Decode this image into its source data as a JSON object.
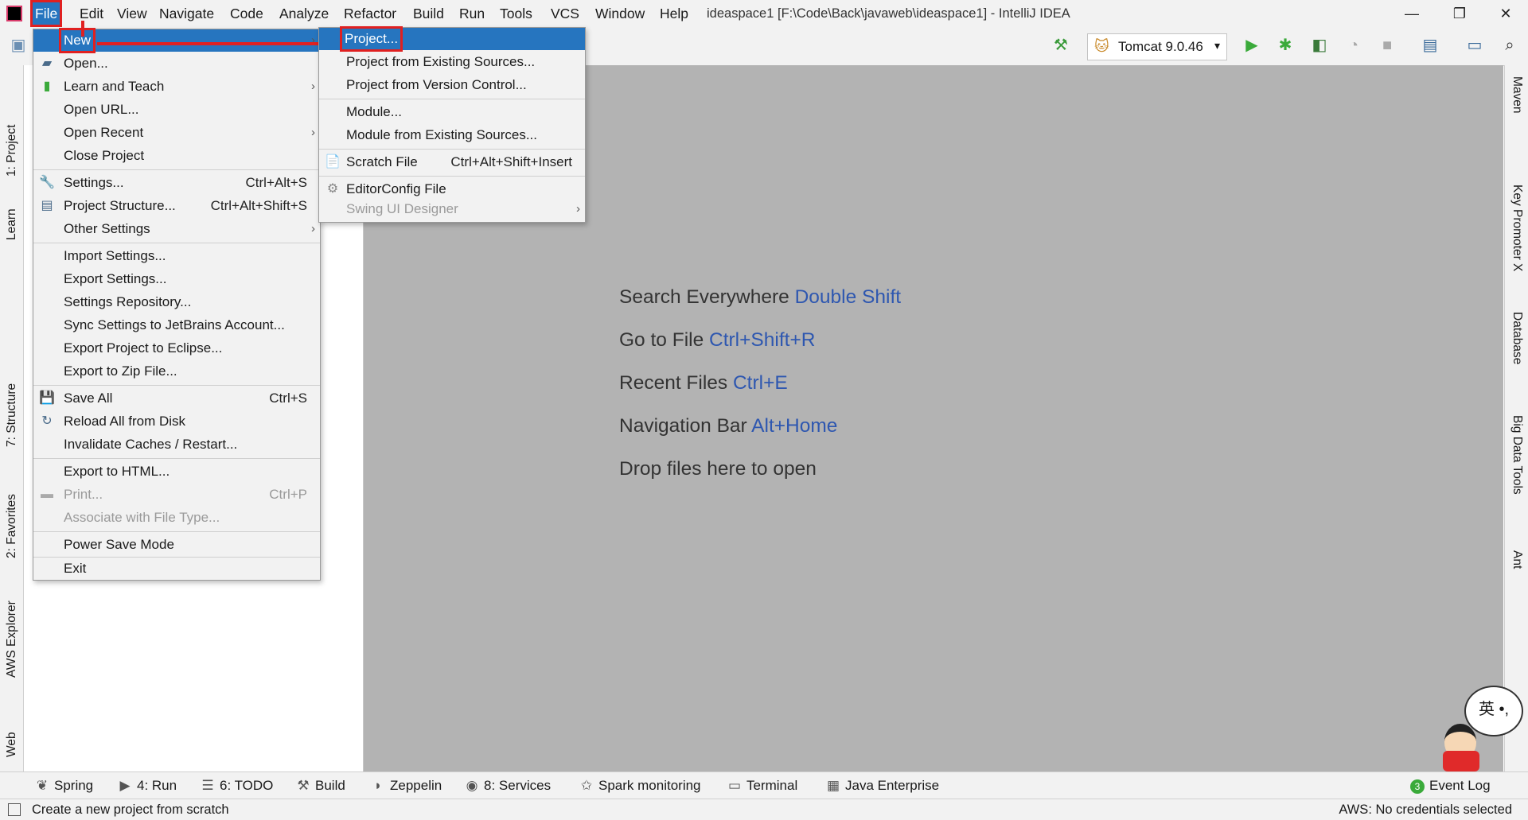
{
  "window": {
    "title": "ideaspace1 [F:\\Code\\Back\\javaweb\\ideaspace1] - IntelliJ IDEA",
    "minimize": "—",
    "restore": "❐",
    "close": "✕"
  },
  "menubar": [
    "File",
    "Edit",
    "View",
    "Navigate",
    "Code",
    "Analyze",
    "Refactor",
    "Build",
    "Run",
    "Tools",
    "VCS",
    "Window",
    "Help"
  ],
  "toolbar": {
    "run_config": "Tomcat 9.0.46"
  },
  "file_menu": {
    "items": [
      {
        "label": "New",
        "shortcut": "",
        "submenu": true,
        "selected": true
      },
      {
        "label": "Open...",
        "shortcut": "",
        "icon": "folder-icon"
      },
      {
        "label": "Learn and Teach",
        "shortcut": "",
        "submenu": true,
        "icon": "book-icon"
      },
      {
        "label": "Open URL...",
        "shortcut": ""
      },
      {
        "label": "Open Recent",
        "shortcut": "",
        "submenu": true
      },
      {
        "label": "Close Project",
        "shortcut": ""
      },
      {
        "label": "Settings...",
        "shortcut": "Ctrl+Alt+S",
        "icon": "wrench-icon"
      },
      {
        "label": "Project Structure...",
        "shortcut": "Ctrl+Alt+Shift+S",
        "icon": "project-structure-icon"
      },
      {
        "label": "Other Settings",
        "shortcut": "",
        "submenu": true
      },
      {
        "label": "Import Settings...",
        "shortcut": ""
      },
      {
        "label": "Export Settings...",
        "shortcut": ""
      },
      {
        "label": "Settings Repository...",
        "shortcut": ""
      },
      {
        "label": "Sync Settings to JetBrains Account...",
        "shortcut": ""
      },
      {
        "label": "Export Project to Eclipse...",
        "shortcut": ""
      },
      {
        "label": "Export to Zip File...",
        "shortcut": ""
      },
      {
        "label": "Save All",
        "shortcut": "Ctrl+S",
        "icon": "save-icon"
      },
      {
        "label": "Reload All from Disk",
        "shortcut": "",
        "icon": "reload-icon"
      },
      {
        "label": "Invalidate Caches / Restart...",
        "shortcut": ""
      },
      {
        "label": "Export to HTML...",
        "shortcut": ""
      },
      {
        "label": "Print...",
        "shortcut": "Ctrl+P",
        "disabled": true,
        "icon": "print-icon"
      },
      {
        "label": "Associate with File Type...",
        "shortcut": "",
        "disabled": true
      },
      {
        "label": "Power Save Mode",
        "shortcut": ""
      },
      {
        "label": "Exit",
        "shortcut": ""
      }
    ]
  },
  "new_submenu": {
    "items": [
      {
        "label": "Project...",
        "shortcut": "",
        "selected": true
      },
      {
        "label": "Project from Existing Sources...",
        "shortcut": ""
      },
      {
        "label": "Project from Version Control...",
        "shortcut": ""
      },
      {
        "label": "Module...",
        "shortcut": ""
      },
      {
        "label": "Module from Existing Sources...",
        "shortcut": ""
      },
      {
        "label": "Scratch File",
        "shortcut": "Ctrl+Alt+Shift+Insert",
        "icon": "scratch-file-icon"
      },
      {
        "label": "EditorConfig File",
        "shortcut": "",
        "icon": "gear-icon"
      },
      {
        "label": "Swing UI Designer",
        "shortcut": "",
        "submenu": true,
        "disabled": true
      }
    ]
  },
  "editor_hints": [
    {
      "text": "Search Everywhere ",
      "key": "Double Shift"
    },
    {
      "text": "Go to File ",
      "key": "Ctrl+Shift+R"
    },
    {
      "text": "Recent Files ",
      "key": "Ctrl+E"
    },
    {
      "text": "Navigation Bar ",
      "key": "Alt+Home"
    },
    {
      "text": "Drop files here to open",
      "key": ""
    }
  ],
  "left_tabs": [
    "1: Project",
    "Learn",
    "7: Structure",
    "2: Favorites",
    "AWS Explorer",
    "Web"
  ],
  "right_tabs": [
    "Maven",
    "Key Promoter X",
    "Database",
    "Big Data Tools",
    "Ant"
  ],
  "bottom_tabs": [
    "Spring",
    "4: Run",
    "6: TODO",
    "Build",
    "Zeppelin",
    "8: Services",
    "Spark monitoring",
    "Terminal",
    "Java Enterprise"
  ],
  "event_log": {
    "count": "3",
    "label": "Event Log"
  },
  "status": {
    "message": "Create a new project from scratch",
    "aws": "AWS: No credentials selected"
  },
  "mascot": {
    "bubble_text": "英 •,"
  },
  "colors": {
    "selection": "#2675bf",
    "highlight": "#e02020",
    "editor_bg": "#b3b3b3",
    "hint_key": "#2e57b0"
  }
}
